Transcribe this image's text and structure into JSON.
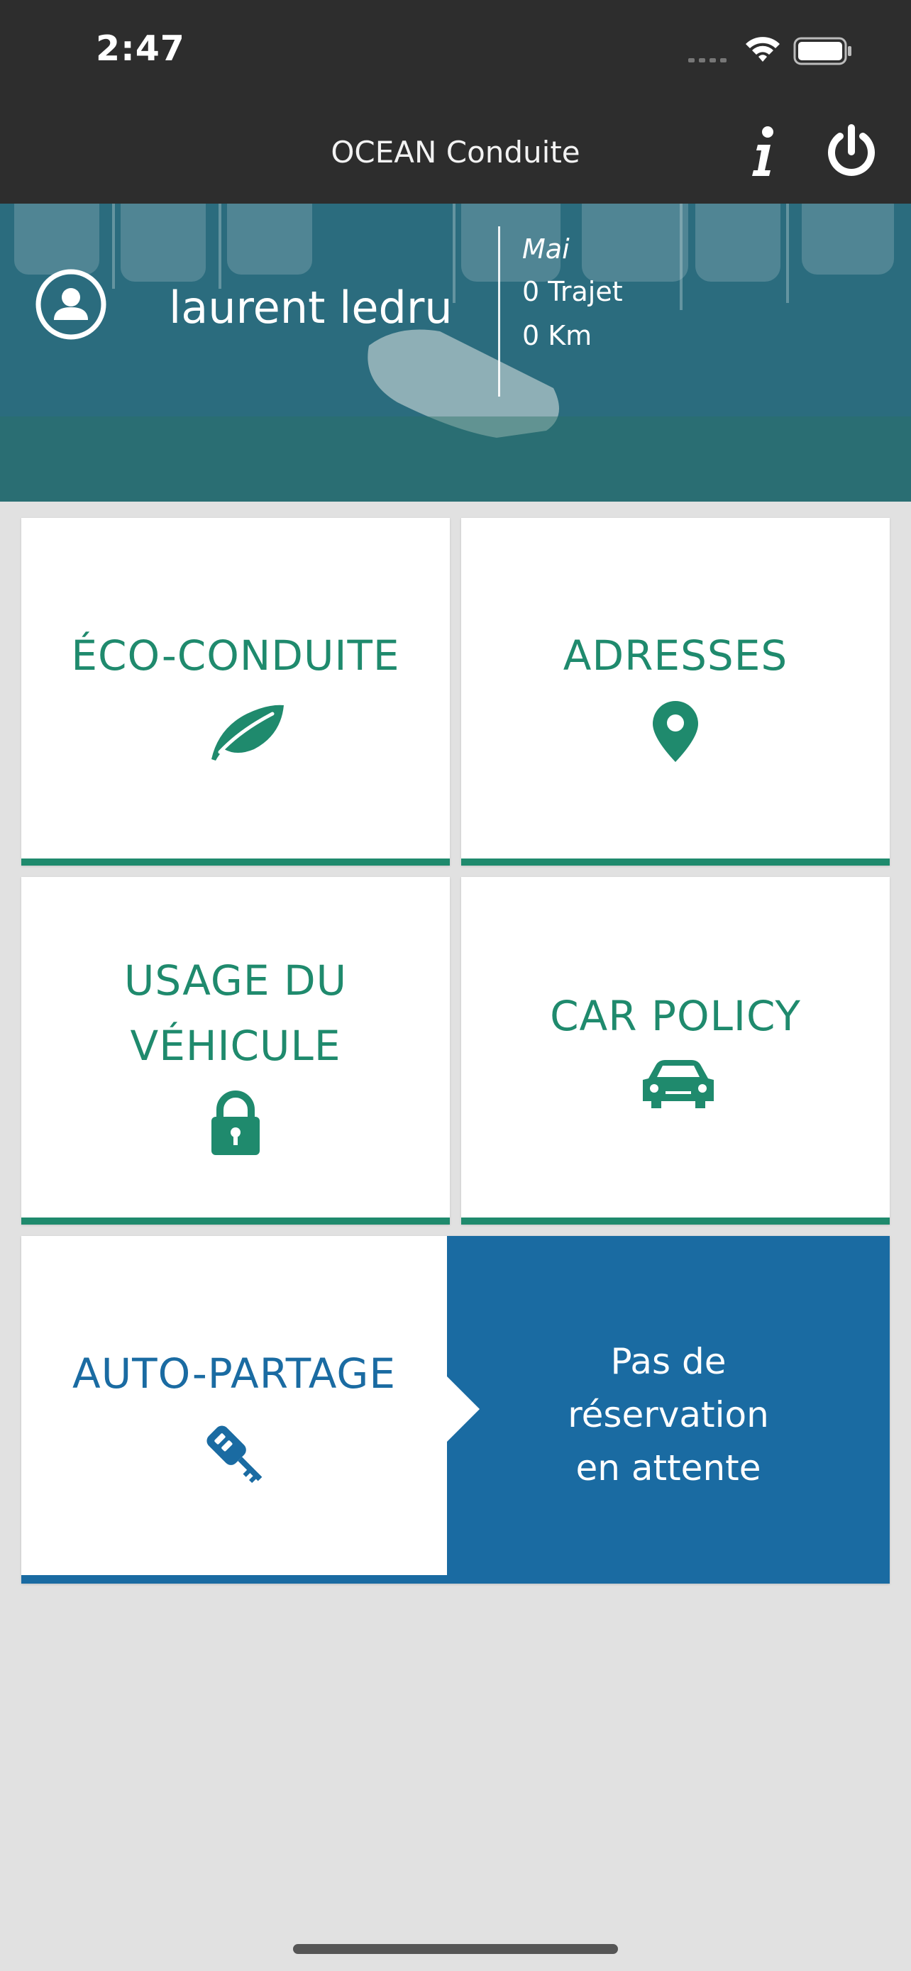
{
  "status_bar": {
    "time": "2:47"
  },
  "app_bar": {
    "title": "OCEAN Conduite"
  },
  "profile": {
    "name": "laurent ledru",
    "month": "Mai",
    "trips": "0 Trajet",
    "distance": "0 Km"
  },
  "tiles": [
    {
      "label": "ÉCO-CONDUITE",
      "icon": "leaf-icon"
    },
    {
      "label": "ADRESSES",
      "icon": "map-pin-icon"
    },
    {
      "label_line1": "USAGE DU",
      "label_line2": "VÉHICULE",
      "icon": "lock-icon"
    },
    {
      "label": "CAR POLICY",
      "icon": "car-icon"
    }
  ],
  "car_sharing": {
    "label": "AUTO-PARTAGE",
    "icon": "car-key-icon",
    "status_line1": "Pas de",
    "status_line2": "réservation",
    "status_line3": "en attente"
  },
  "colors": {
    "accent_green": "#1f8a6d",
    "accent_blue": "#1a6ba2",
    "bar_dark": "#2d2d2d"
  }
}
